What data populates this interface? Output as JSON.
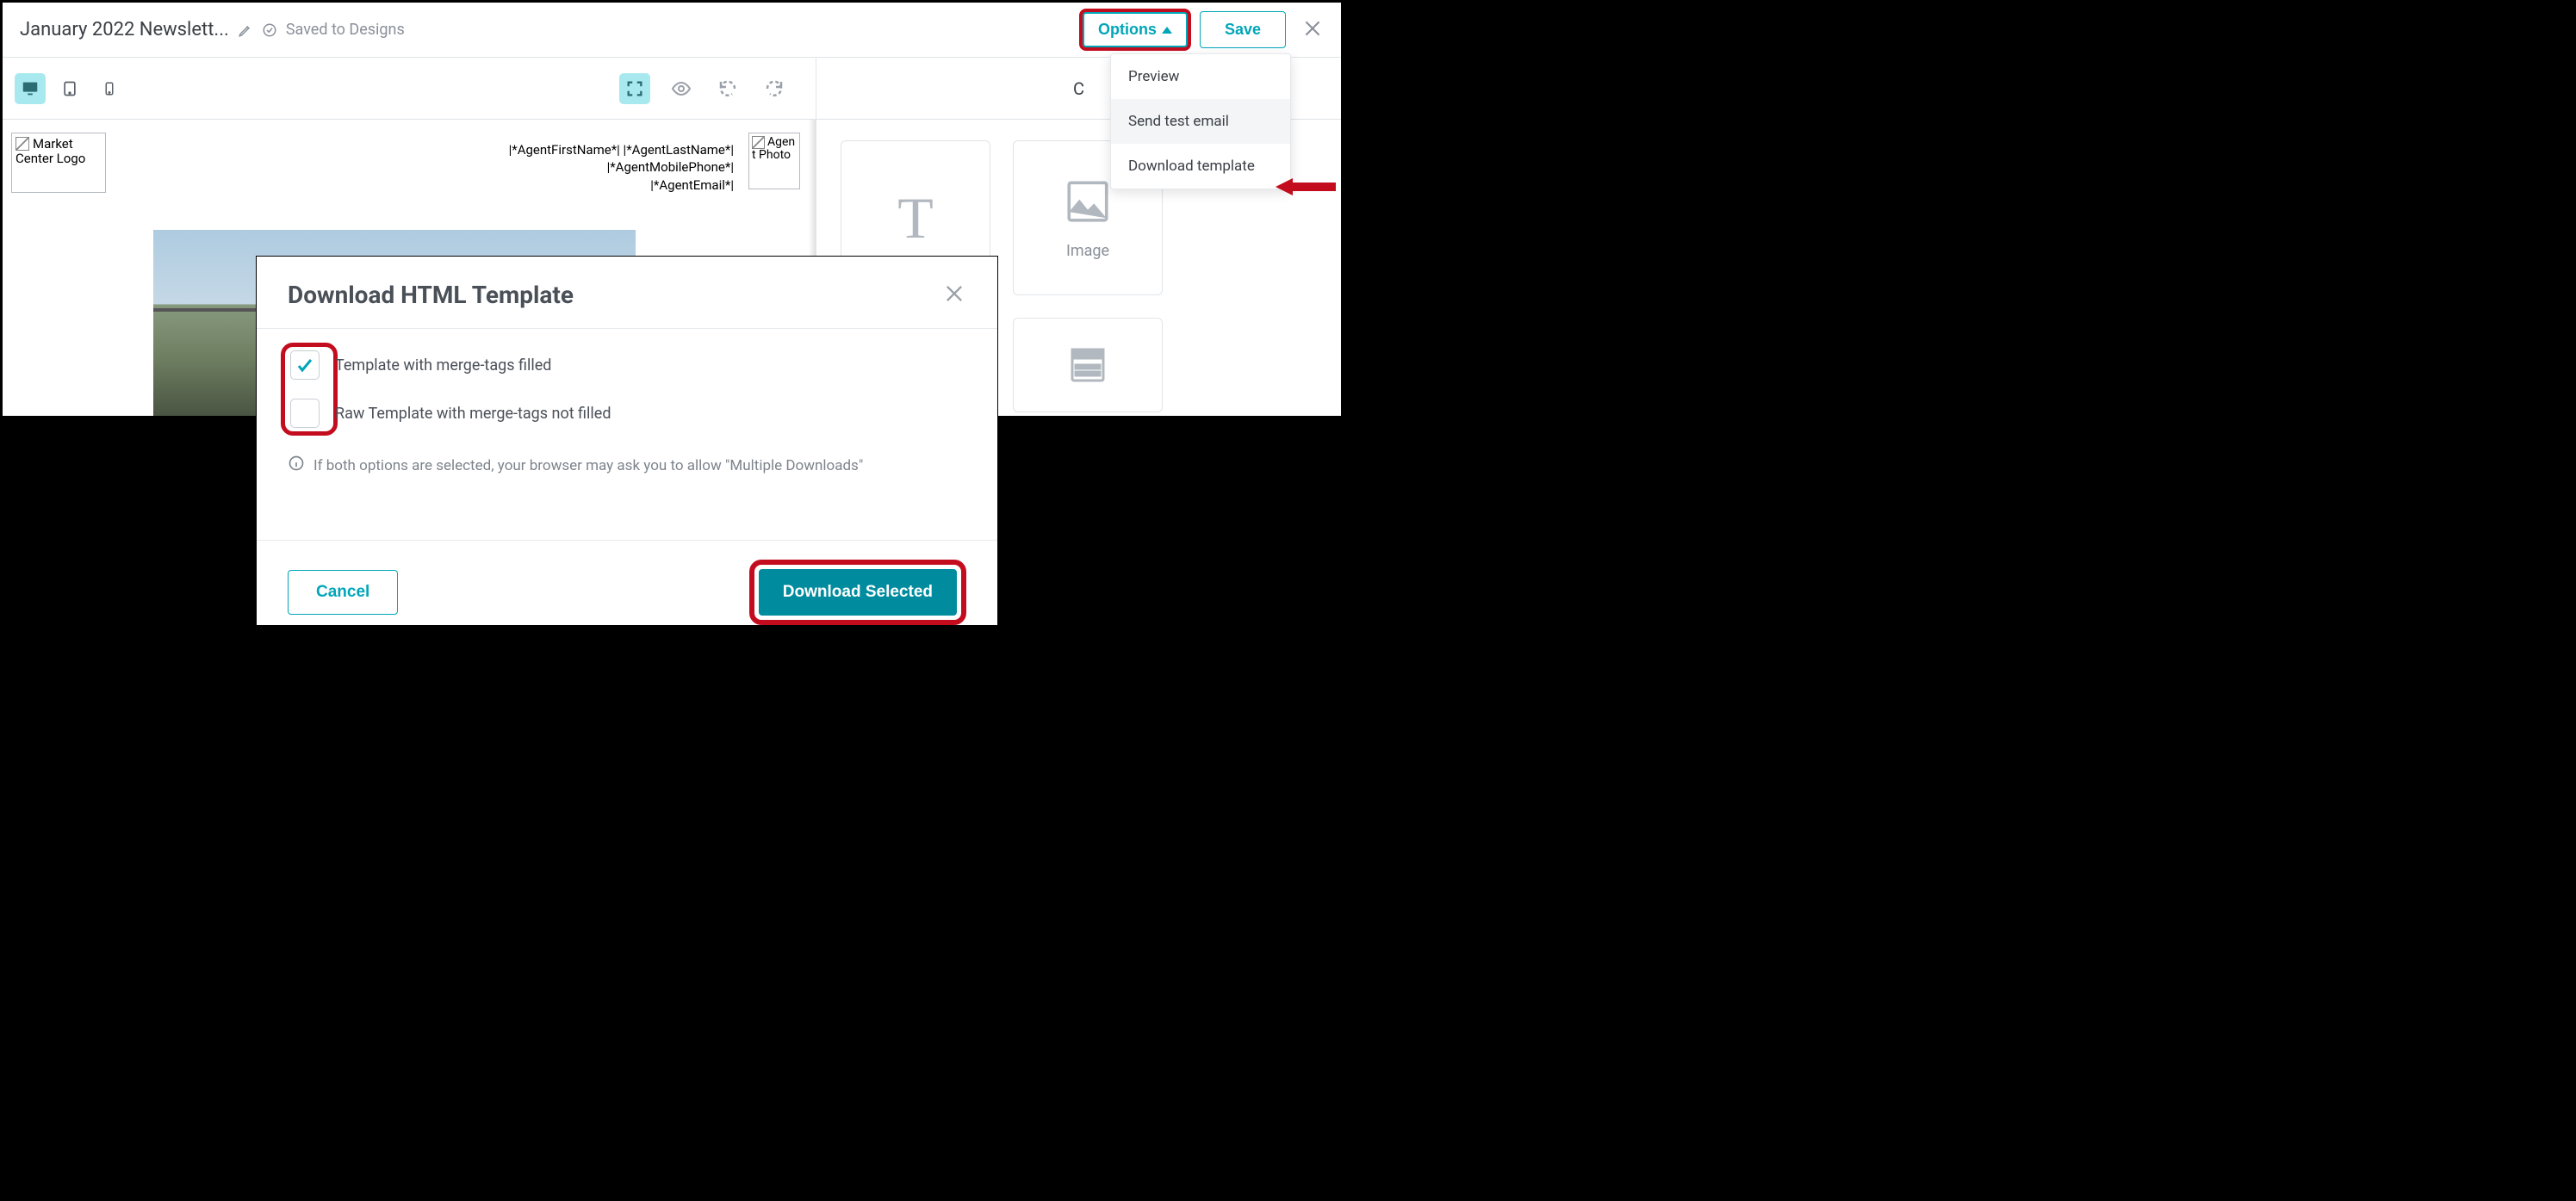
{
  "header": {
    "title": "January 2022 Newslett...",
    "saved_label": "Saved to Designs",
    "options_label": "Options",
    "save_label": "Save"
  },
  "dropdown": {
    "items": [
      "Preview",
      "Send test email",
      "Download template"
    ],
    "hover_index": 1
  },
  "right_panel": {
    "tab_label_prefix": "C",
    "blocks": {
      "text": "",
      "image": "Image"
    }
  },
  "canvas": {
    "market_center_logo_alt": "Market Center Logo",
    "agent_lines": [
      "|*AgentFirstName*| |*AgentLastName*|",
      "|*AgentMobilePhone*|",
      "|*AgentEmail*|"
    ],
    "agent_photo_alt": "Agent Photo"
  },
  "modal": {
    "title": "Download HTML Template",
    "option1": "Template with merge-tags filled",
    "option1_checked": true,
    "option2": "Raw Template with merge-tags not filled",
    "option2_checked": false,
    "info": "If both options are selected, your browser may ask you to allow \"Multiple Downloads\"",
    "cancel": "Cancel",
    "download": "Download Selected"
  }
}
